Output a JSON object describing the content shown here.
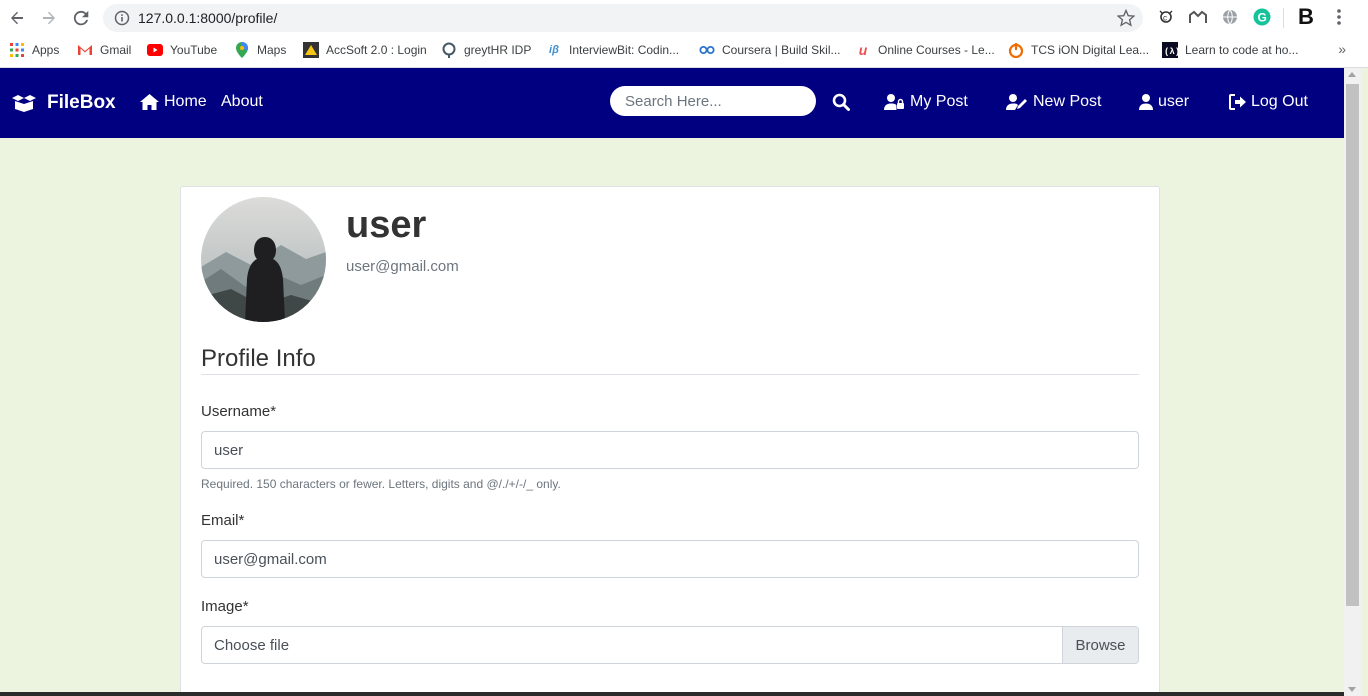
{
  "browser": {
    "url": "127.0.0.1:8000/profile/",
    "bookmarks": [
      {
        "label": "Apps",
        "icon": "apps-grid-icon"
      },
      {
        "label": "Gmail",
        "icon": "gmail-icon"
      },
      {
        "label": "YouTube",
        "icon": "youtube-icon"
      },
      {
        "label": "Maps",
        "icon": "maps-icon"
      },
      {
        "label": "AccSoft 2.0 : Login",
        "icon": "accsoft-icon"
      },
      {
        "label": "greytHR IDP",
        "icon": "greythr-icon"
      },
      {
        "label": "InterviewBit: Codin...",
        "icon": "interviewbit-icon"
      },
      {
        "label": "Coursera | Build Skil...",
        "icon": "coursera-icon"
      },
      {
        "label": "Online Courses - Le...",
        "icon": "udemy-icon"
      },
      {
        "label": "TCS iON Digital Lea...",
        "icon": "tcs-icon"
      },
      {
        "label": "Learn to code at ho...",
        "icon": "freecodecamp-icon"
      }
    ],
    "more": "»"
  },
  "navbar": {
    "brand": "FileBox",
    "home": "Home",
    "about": "About",
    "search_placeholder": "Search Here...",
    "my_post": "My Post",
    "new_post": "New Post",
    "user": "user",
    "logout": "Log Out",
    "color": "#000080"
  },
  "profile": {
    "name": "user",
    "email": "user@gmail.com"
  },
  "form": {
    "section_title": "Profile Info",
    "username_label": "Username*",
    "username_value": "user",
    "username_help": "Required. 150 characters or fewer. Letters, digits and @/./+/-/_ only.",
    "email_label": "Email*",
    "email_value": "user@gmail.com",
    "image_label": "Image*",
    "file_placeholder": "Choose file",
    "browse": "Browse"
  },
  "theme": {
    "page_bg": "#ecf3df"
  }
}
